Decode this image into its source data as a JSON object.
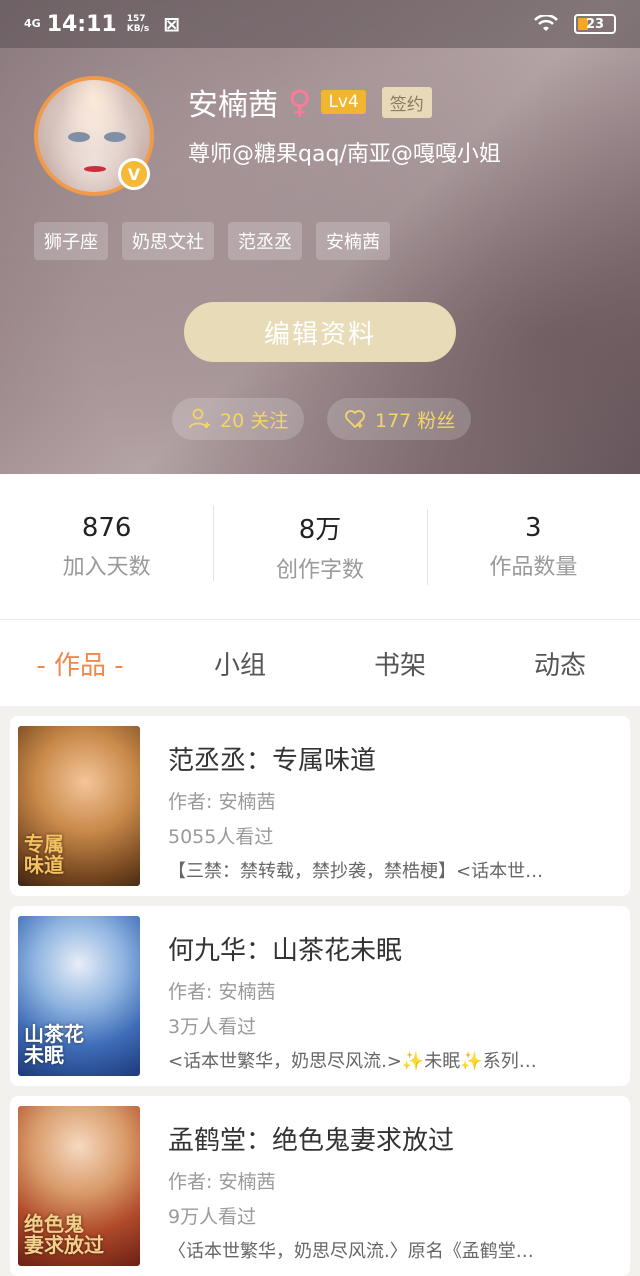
{
  "statusbar": {
    "signal": "4G",
    "time": "14:11",
    "net_speed": "157",
    "net_unit": "KB/s",
    "battery": "23"
  },
  "profile": {
    "name": "安楠茜",
    "gender_symbol": "♀",
    "level": "Lv4",
    "contract": "签约",
    "bio": "尊师@糖果qaq/南亚@嘎嘎小姐",
    "verified_badge": "V",
    "tags": [
      "狮子座",
      "奶思文社",
      "范丞丞",
      "安楠茜"
    ],
    "edit_label": "编辑资料",
    "following": "20 关注",
    "followers": "177 粉丝"
  },
  "stats": [
    {
      "value": "876",
      "label": "加入天数"
    },
    {
      "value": "8万",
      "label": "创作字数"
    },
    {
      "value": "3",
      "label": "作品数量"
    }
  ],
  "tabs": [
    "- 作品 -",
    "小组",
    "书架",
    "动态"
  ],
  "works": [
    {
      "title": "范丞丞：专属味道",
      "author": "作者: 安楠茜",
      "views": "5055人看过",
      "desc": "【三禁：禁转载，禁抄袭，禁梏梗】<话本世…"
    },
    {
      "title": "何九华：山茶花未眠",
      "author": "作者: 安楠茜",
      "views": "3万人看过",
      "desc": "<话本世繁华，奶思尽风流.>✨未眠✨系列…"
    },
    {
      "title": "孟鹤堂：绝色鬼妻求放过",
      "author": "作者: 安楠茜",
      "views": "9万人看过",
      "desc": "〈话本世繁华，奶思尽风流.〉原名《孟鹤堂…"
    }
  ],
  "colors": {
    "accent": "#f0884c",
    "gold": "#f3d56a",
    "button": "#e7dbb8"
  }
}
